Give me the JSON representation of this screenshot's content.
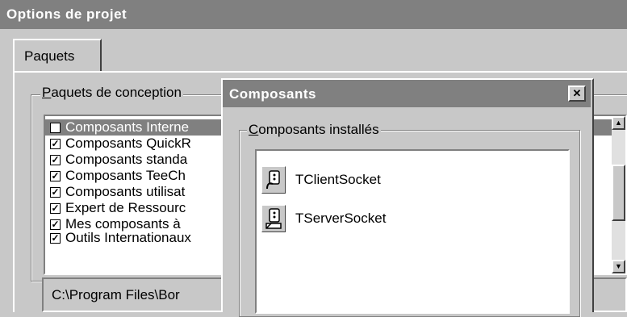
{
  "main_window": {
    "title": "Options de projet",
    "tab_label": "Paquets",
    "group_label_prefix": "P",
    "group_label_rest": "aquets de conception",
    "packages": [
      {
        "label": "Composants Interne",
        "checked": true,
        "selected": true
      },
      {
        "label": "Composants QuickR",
        "checked": true,
        "selected": false
      },
      {
        "label": "Composants standa",
        "checked": true,
        "selected": false
      },
      {
        "label": "Composants TeeCh",
        "checked": true,
        "selected": false
      },
      {
        "label": "Composants utilisat",
        "checked": true,
        "selected": false
      },
      {
        "label": "Expert de Ressourc",
        "checked": true,
        "selected": false
      },
      {
        "label": "Mes composants à",
        "checked": true,
        "selected": false
      },
      {
        "label": "Outils Internationaux",
        "checked": true,
        "selected": false
      }
    ],
    "path_text": "C:\\Program Files\\Bor"
  },
  "dialog": {
    "title": "Composants",
    "close_glyph": "✕",
    "group_label_prefix": "C",
    "group_label_rest": "omposants installés",
    "components": [
      {
        "label": "TClientSocket",
        "icon": "client-socket-icon"
      },
      {
        "label": "TServerSocket",
        "icon": "server-socket-icon"
      }
    ]
  },
  "colors": {
    "face": "#c8c8c8",
    "titlebar": "#808080",
    "selection": "#808080"
  }
}
